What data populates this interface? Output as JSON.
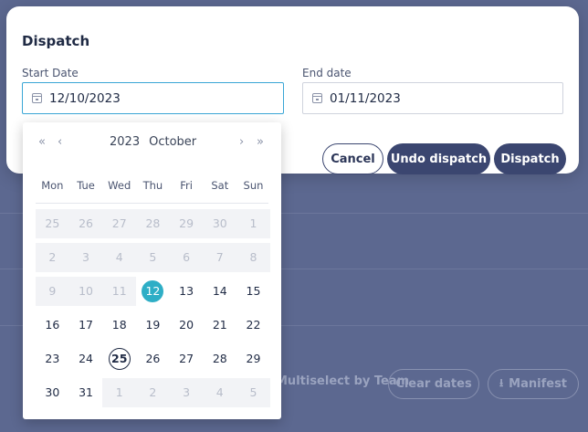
{
  "background": {
    "multiselect_text": "Multiselect by Team",
    "clear_dates_label": "Clear dates",
    "manifest_label": "Manifest",
    "manifest_icon": "download-icon"
  },
  "modal": {
    "title": "Dispatch",
    "start_date": {
      "label": "Start Date",
      "value": "12/10/2023"
    },
    "end_date": {
      "label": "End date",
      "value": "01/11/2023"
    },
    "buttons": {
      "cancel": "Cancel",
      "undo": "Undo dispatch",
      "dispatch": "Dispatch"
    }
  },
  "calendar": {
    "year": "2023",
    "month": "October",
    "nav": {
      "prev_year": "«",
      "prev_month": "‹",
      "next_month": "›",
      "next_year": "»"
    },
    "weekdays": [
      "Mon",
      "Tue",
      "Wed",
      "Thu",
      "Fri",
      "Sat",
      "Sun"
    ],
    "weeks": [
      [
        {
          "d": "25",
          "s": "disabled"
        },
        {
          "d": "26",
          "s": "disabled"
        },
        {
          "d": "27",
          "s": "disabled"
        },
        {
          "d": "28",
          "s": "disabled"
        },
        {
          "d": "29",
          "s": "disabled"
        },
        {
          "d": "30",
          "s": "disabled"
        },
        {
          "d": "1",
          "s": "disabled"
        }
      ],
      [
        {
          "d": "2",
          "s": "disabled"
        },
        {
          "d": "3",
          "s": "disabled"
        },
        {
          "d": "4",
          "s": "disabled"
        },
        {
          "d": "5",
          "s": "disabled"
        },
        {
          "d": "6",
          "s": "disabled"
        },
        {
          "d": "7",
          "s": "disabled"
        },
        {
          "d": "8",
          "s": "disabled"
        }
      ],
      [
        {
          "d": "9",
          "s": "disabled"
        },
        {
          "d": "10",
          "s": "disabled"
        },
        {
          "d": "11",
          "s": "disabled"
        },
        {
          "d": "12",
          "s": "selected"
        },
        {
          "d": "13",
          "s": ""
        },
        {
          "d": "14",
          "s": ""
        },
        {
          "d": "15",
          "s": ""
        }
      ],
      [
        {
          "d": "16",
          "s": ""
        },
        {
          "d": "17",
          "s": ""
        },
        {
          "d": "18",
          "s": ""
        },
        {
          "d": "19",
          "s": ""
        },
        {
          "d": "20",
          "s": ""
        },
        {
          "d": "21",
          "s": ""
        },
        {
          "d": "22",
          "s": ""
        }
      ],
      [
        {
          "d": "23",
          "s": ""
        },
        {
          "d": "24",
          "s": ""
        },
        {
          "d": "25",
          "s": "today"
        },
        {
          "d": "26",
          "s": ""
        },
        {
          "d": "27",
          "s": ""
        },
        {
          "d": "28",
          "s": ""
        },
        {
          "d": "29",
          "s": ""
        }
      ],
      [
        {
          "d": "30",
          "s": ""
        },
        {
          "d": "31",
          "s": ""
        },
        {
          "d": "1",
          "s": "disabled"
        },
        {
          "d": "2",
          "s": "disabled"
        },
        {
          "d": "3",
          "s": "disabled"
        },
        {
          "d": "4",
          "s": "disabled"
        },
        {
          "d": "5",
          "s": "disabled"
        }
      ]
    ]
  },
  "colors": {
    "accent": "#2eaec6",
    "primary_button": "#3b4670",
    "overlay": "#5c6890"
  }
}
